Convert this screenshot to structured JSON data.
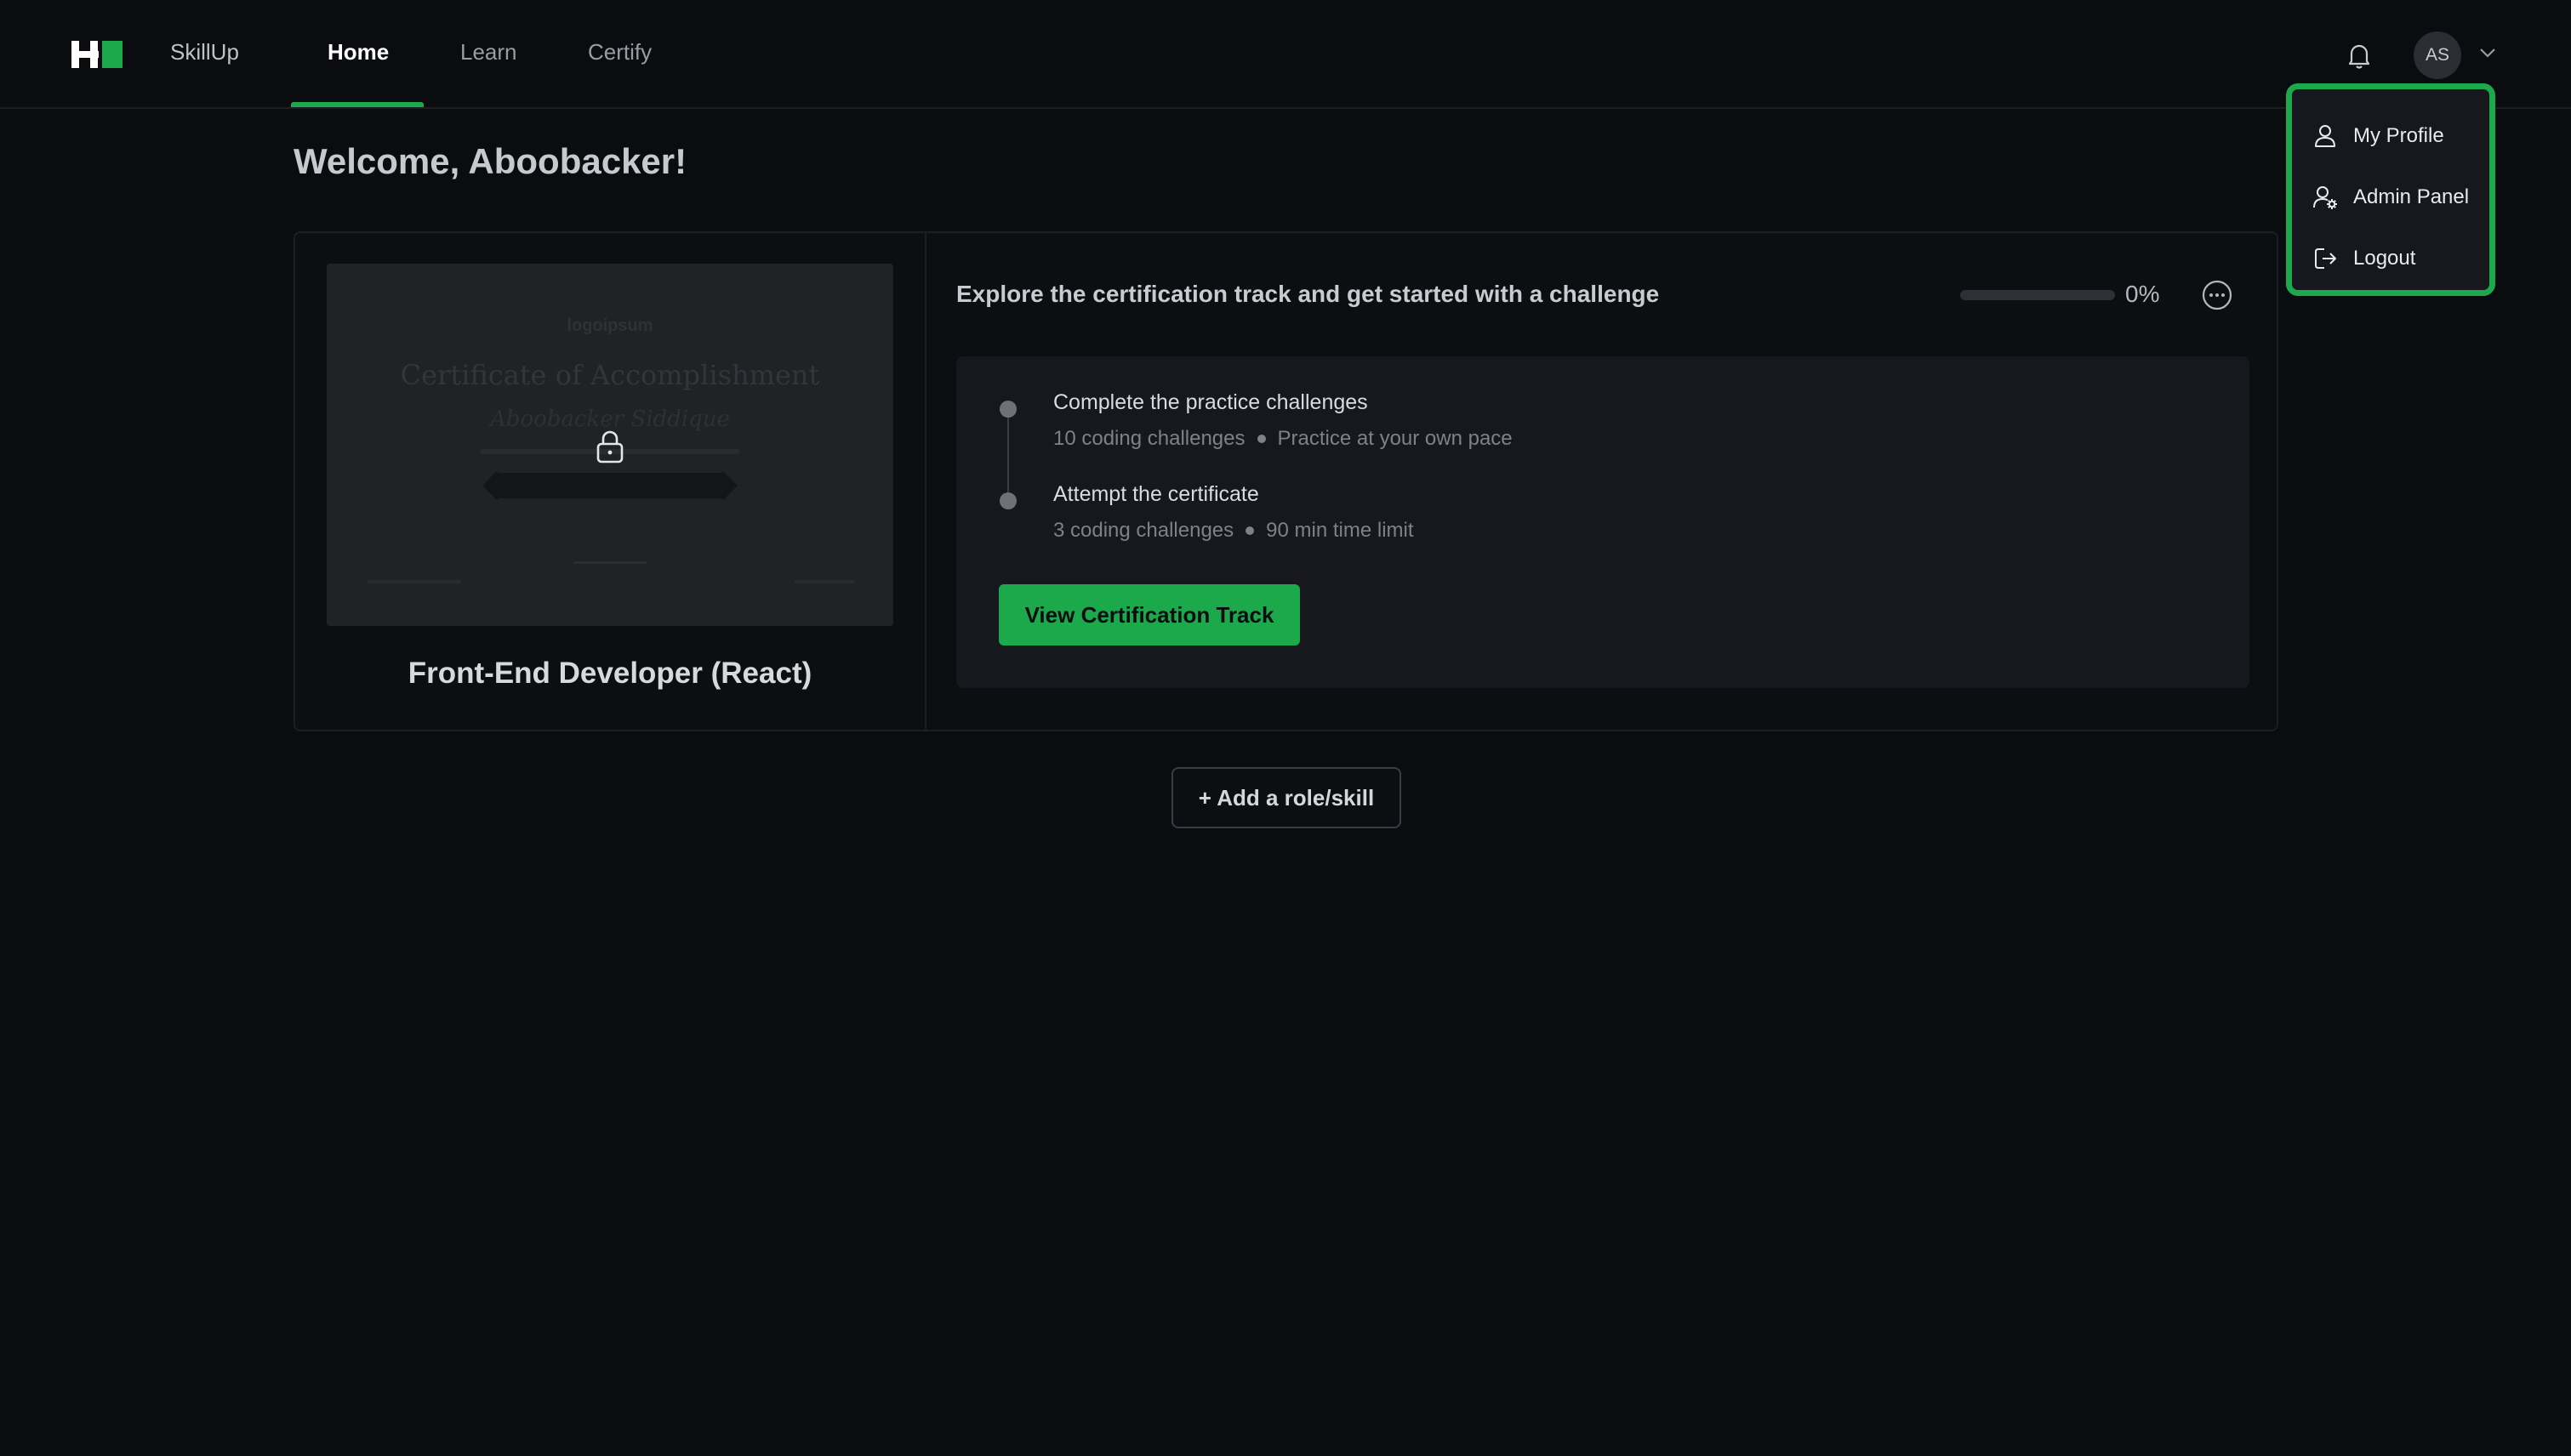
{
  "nav": {
    "brand": "SkillUp",
    "tabs": [
      {
        "label": "Home",
        "active": true
      },
      {
        "label": "Learn",
        "active": false
      },
      {
        "label": "Certify",
        "active": false
      }
    ],
    "avatar_initials": "AS"
  },
  "user_menu": {
    "items": [
      {
        "label": "My Profile",
        "icon": "user-icon"
      },
      {
        "label": "Admin Panel",
        "icon": "user-gear-icon"
      },
      {
        "label": "Logout",
        "icon": "logout-icon"
      }
    ]
  },
  "main": {
    "welcome": "Welcome, Aboobacker!",
    "card": {
      "certificate_preview": {
        "logo_text": "logoipsum",
        "title": "Certificate of Accomplishment",
        "recipient": "Aboobacker Siddique"
      },
      "role_name": "Front-End Developer (React)",
      "heading": "Explore the certification track and get started with a challenge",
      "progress": {
        "value": 0,
        "text": "0%"
      },
      "steps": [
        {
          "title": "Complete the practice challenges",
          "meta": [
            "10 coding challenges",
            "Practice at your own pace"
          ]
        },
        {
          "title": "Attempt the certificate",
          "meta": [
            "3 coding challenges",
            "90 min time limit"
          ]
        }
      ],
      "cta_label": "View Certification Track"
    },
    "add_role_label": "+ Add a role/skill"
  },
  "colors": {
    "accent": "#1ba94c",
    "background": "#0b0c10",
    "panel": "#17181d"
  }
}
